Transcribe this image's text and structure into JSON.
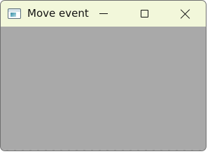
{
  "window": {
    "title": "Move event",
    "icon": "window-app-icon",
    "colors": {
      "titlebar": "#f2f7da",
      "client": "#a9a9a9",
      "border": "#6f6f6f"
    }
  },
  "titlebar_buttons": {
    "minimize_icon": "minimize-icon",
    "maximize_icon": "maximize-icon",
    "close_icon": "close-icon"
  }
}
